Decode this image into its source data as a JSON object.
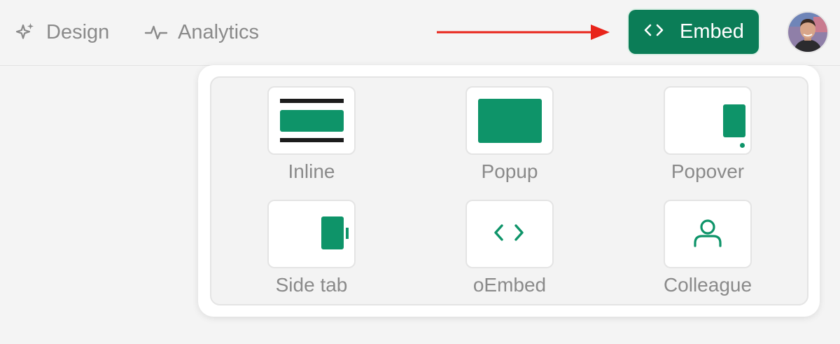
{
  "nav": {
    "items": [
      {
        "label": "Design",
        "icon": "sparkles-icon"
      },
      {
        "label": "Analytics",
        "icon": "pulse-icon"
      }
    ]
  },
  "embed_button": {
    "label": "Embed",
    "icon": "code-brackets-icon"
  },
  "colors": {
    "primary": "#0b7d57",
    "tile_green": "#0e9469",
    "arrow": "#e8241a"
  },
  "embed_options": [
    {
      "label": "Inline",
      "icon": "inline-embed-icon"
    },
    {
      "label": "Popup",
      "icon": "popup-embed-icon"
    },
    {
      "label": "Popover",
      "icon": "popover-embed-icon"
    },
    {
      "label": "Side tab",
      "icon": "side-tab-embed-icon"
    },
    {
      "label": "oEmbed",
      "icon": "code-brackets-icon"
    },
    {
      "label": "Colleague",
      "icon": "person-icon"
    }
  ]
}
